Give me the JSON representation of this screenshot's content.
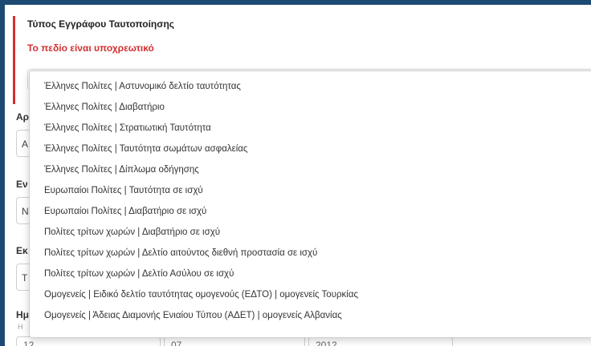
{
  "field": {
    "label": "Τύπος Εγγράφου Ταυτοποίησης",
    "error": "Το πεδίο είναι υποχρεωτικό"
  },
  "background_form": {
    "label_1": "Αρ",
    "value_1": "Α",
    "label_2": "Εν",
    "value_2": "Ν",
    "label_3": "Εκ",
    "value_3": "Τ",
    "label_4": "Ημ",
    "hint_4": "Η",
    "date_day": "12",
    "date_month": "07",
    "date_year": "2012"
  },
  "dropdown": {
    "options": [
      "Έλληνες Πολίτες | Αστυνομικό δελτίο ταυτότητας",
      "Έλληνες Πολίτες | Διαβατήριο",
      "Έλληνες Πολίτες | Στρατιωτική Ταυτότητα",
      "Έλληνες Πολίτες | Ταυτότητα σωμάτων ασφαλείας",
      "Έλληνες Πολίτες | Δίπλωμα οδήγησης",
      "Ευρωπαίοι Πολίτες | Ταυτότητα σε ισχύ",
      "Ευρωπαίοι Πολίτες | Διαβατήριο σε ισχύ",
      "Πολίτες τρίτων χωρών | Διαβατήριο σε ισχύ",
      "Πολίτες τρίτων χωρών | Δελτίο αιτούντος διεθνή προστασία σε ισχύ",
      "Πολίτες τρίτων χωρών | Δελτίο Ασύλου σε ισχύ",
      "Ομογενείς | Ειδικό δελτίο ταυτότητας ομογενούς (ΕΔΤΟ) | ομογενείς Τουρκίας",
      "Ομογενείς | Άδειας Διαμονής Ενιαίου Τύπου (ΑΔΕΤ) | ομογενείς Αλβανίας"
    ]
  },
  "colors": {
    "outer_background": "#1d4a72",
    "error_red": "#d32f2f"
  }
}
